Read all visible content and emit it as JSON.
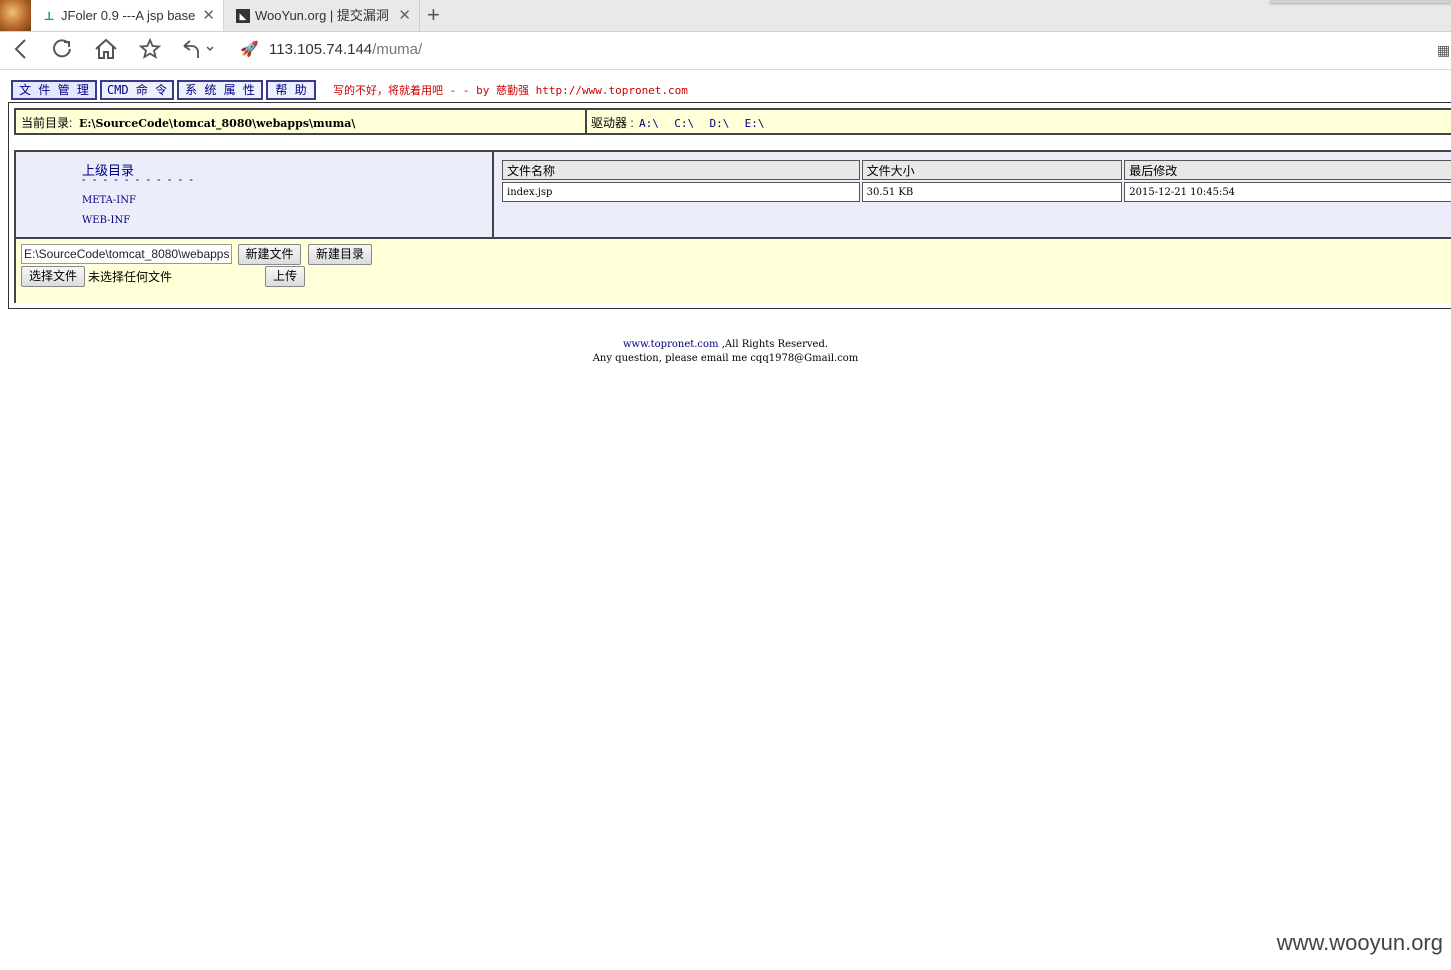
{
  "browser": {
    "tabs": [
      {
        "title": "JFoler 0.9 ---A jsp base"
      },
      {
        "title": "WooYun.org | 提交漏洞"
      }
    ],
    "address": "113.105.74.144/muma/",
    "address_host": "113.105.74.144",
    "address_path": "/muma/"
  },
  "menu": {
    "items": [
      "文 件 管 理",
      "CMD 命 令",
      "系 统 属 性",
      "帮 助"
    ],
    "tagline": "写的不好，将就着用吧 - - by 慈勤强 http://www.topronet.com"
  },
  "pathbar": {
    "label": "当前目录:",
    "current_dir": "E:\\SourceCode\\tomcat_8080\\webapps\\muma\\",
    "drives_label": "驱动器 :",
    "drives": [
      "A:\\",
      "C:\\",
      "D:\\",
      "E:\\"
    ]
  },
  "dirs": {
    "parent_label": "上级目录",
    "dashes": "- - - - - - - - - - -",
    "items": [
      "META-INF",
      "WEB-INF"
    ]
  },
  "files": {
    "columns": [
      "文件名称",
      "文件大小",
      "最后修改"
    ],
    "rows": [
      {
        "name": "index.jsp",
        "size": "30.51 KB",
        "modified": "2015-12-21 10:45:54"
      }
    ]
  },
  "actions": {
    "path_value": "E:\\SourceCode\\tomcat_8080\\webapps",
    "new_file": "新建文件",
    "new_dir": "新建目录",
    "choose_file": "选择文件",
    "no_file": "未选择任何文件",
    "upload": "上传"
  },
  "footer": {
    "site": "www.topronet.com",
    "rights": " ,All Rights Reserved.",
    "contact": "Any question, please email me cqq1978@Gmail.com"
  },
  "watermark": "www.wooyun.org"
}
